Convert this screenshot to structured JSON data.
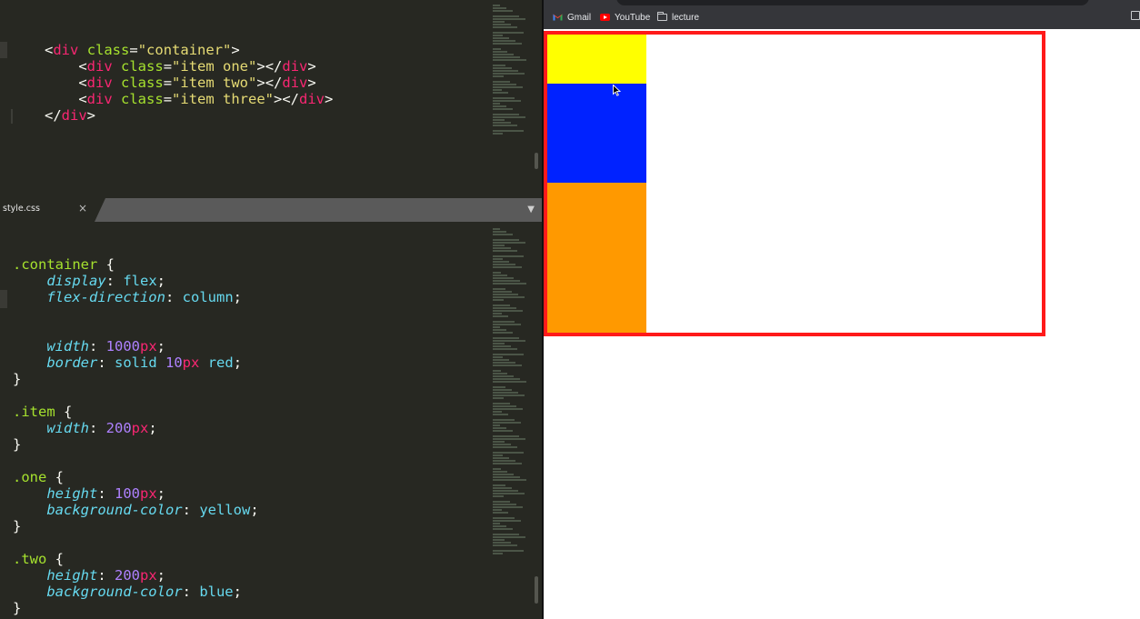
{
  "editor": {
    "html_lines": [
      [
        [
          "<",
          "punc"
        ],
        [
          "div",
          "tag"
        ],
        [
          " ",
          "punc"
        ],
        [
          "class",
          "attr"
        ],
        [
          "=",
          "punc"
        ],
        [
          "\"container\"",
          "str"
        ],
        [
          ">",
          "punc"
        ]
      ],
      [
        [
          "    <",
          "punc"
        ],
        [
          "div",
          "tag"
        ],
        [
          " ",
          "punc"
        ],
        [
          "class",
          "attr"
        ],
        [
          "=",
          "punc"
        ],
        [
          "\"item one\"",
          "str"
        ],
        [
          "></",
          "punc"
        ],
        [
          "div",
          "tag"
        ],
        [
          ">",
          "punc"
        ]
      ],
      [
        [
          "    <",
          "punc"
        ],
        [
          "div",
          "tag"
        ],
        [
          " ",
          "punc"
        ],
        [
          "class",
          "attr"
        ],
        [
          "=",
          "punc"
        ],
        [
          "\"item two\"",
          "str"
        ],
        [
          "></",
          "punc"
        ],
        [
          "div",
          "tag"
        ],
        [
          ">",
          "punc"
        ]
      ],
      [
        [
          "    <",
          "punc"
        ],
        [
          "div",
          "tag"
        ],
        [
          " ",
          "punc"
        ],
        [
          "class",
          "attr"
        ],
        [
          "=",
          "punc"
        ],
        [
          "\"item three\"",
          "str"
        ],
        [
          "></",
          "punc"
        ],
        [
          "div",
          "tag"
        ],
        [
          ">",
          "punc"
        ]
      ],
      [
        [
          "</",
          "punc"
        ],
        [
          "div",
          "tag"
        ],
        [
          ">",
          "punc"
        ]
      ]
    ],
    "tab": {
      "label": "style.css",
      "close": "×",
      "dropdown": "▼"
    },
    "css_lines": [
      [
        [
          ".container",
          "sel"
        ],
        [
          " {",
          "punc"
        ]
      ],
      [
        [
          "    ",
          "punc"
        ],
        [
          "display",
          "prop"
        ],
        [
          ": ",
          "punc"
        ],
        [
          "flex",
          "val"
        ],
        [
          ";",
          "punc"
        ]
      ],
      [
        [
          "    ",
          "punc"
        ],
        [
          "flex-direction",
          "prop"
        ],
        [
          ": ",
          "punc"
        ],
        [
          "column",
          "val"
        ],
        [
          ";",
          "punc"
        ]
      ],
      [],
      [],
      [
        [
          "    ",
          "punc"
        ],
        [
          "width",
          "prop"
        ],
        [
          ": ",
          "punc"
        ],
        [
          "1000",
          "num"
        ],
        [
          "px",
          "unit"
        ],
        [
          ";",
          "punc"
        ]
      ],
      [
        [
          "    ",
          "punc"
        ],
        [
          "border",
          "prop"
        ],
        [
          ": ",
          "punc"
        ],
        [
          "solid ",
          "val"
        ],
        [
          "10",
          "num"
        ],
        [
          "px",
          "unit"
        ],
        [
          " ",
          "punc"
        ],
        [
          "red",
          "val"
        ],
        [
          ";",
          "punc"
        ]
      ],
      [
        [
          "}",
          "punc"
        ]
      ],
      [],
      [
        [
          ".item",
          "sel"
        ],
        [
          " {",
          "punc"
        ]
      ],
      [
        [
          "    ",
          "punc"
        ],
        [
          "width",
          "prop"
        ],
        [
          ": ",
          "punc"
        ],
        [
          "200",
          "num"
        ],
        [
          "px",
          "unit"
        ],
        [
          ";",
          "punc"
        ]
      ],
      [
        [
          "}",
          "punc"
        ]
      ],
      [],
      [
        [
          ".one",
          "sel"
        ],
        [
          " {",
          "punc"
        ]
      ],
      [
        [
          "    ",
          "punc"
        ],
        [
          "height",
          "prop"
        ],
        [
          ": ",
          "punc"
        ],
        [
          "100",
          "num"
        ],
        [
          "px",
          "unit"
        ],
        [
          ";",
          "punc"
        ]
      ],
      [
        [
          "    ",
          "punc"
        ],
        [
          "background-color",
          "prop"
        ],
        [
          ": ",
          "punc"
        ],
        [
          "yellow",
          "val"
        ],
        [
          ";",
          "punc"
        ]
      ],
      [
        [
          "}",
          "punc"
        ]
      ],
      [],
      [
        [
          ".two",
          "sel"
        ],
        [
          " {",
          "punc"
        ]
      ],
      [
        [
          "    ",
          "punc"
        ],
        [
          "height",
          "prop"
        ],
        [
          ": ",
          "punc"
        ],
        [
          "200",
          "num"
        ],
        [
          "px",
          "unit"
        ],
        [
          ";",
          "punc"
        ]
      ],
      [
        [
          "    ",
          "punc"
        ],
        [
          "background-color",
          "prop"
        ],
        [
          ": ",
          "punc"
        ],
        [
          "blue",
          "val"
        ],
        [
          ";",
          "punc"
        ]
      ],
      [
        [
          "}",
          "punc"
        ]
      ]
    ]
  },
  "browser": {
    "bookmarks": [
      {
        "label": "Gmail",
        "icon": "gmail-icon"
      },
      {
        "label": "YouTube",
        "icon": "youtube-icon"
      },
      {
        "label": "lecture",
        "icon": "folder-icon"
      }
    ],
    "page": {
      "container_border_color": "#ff1a1a",
      "items": [
        {
          "class": "one",
          "color": "#ffff00"
        },
        {
          "class": "two",
          "color": "#0022ff"
        },
        {
          "class": "three",
          "color": "#ff9900"
        }
      ]
    }
  },
  "colors": {
    "editor_bg": "#272822",
    "tag": "#f92672",
    "attr": "#a6e22e",
    "string": "#e6db74",
    "property": "#66d9ef",
    "number": "#ae81ff"
  }
}
